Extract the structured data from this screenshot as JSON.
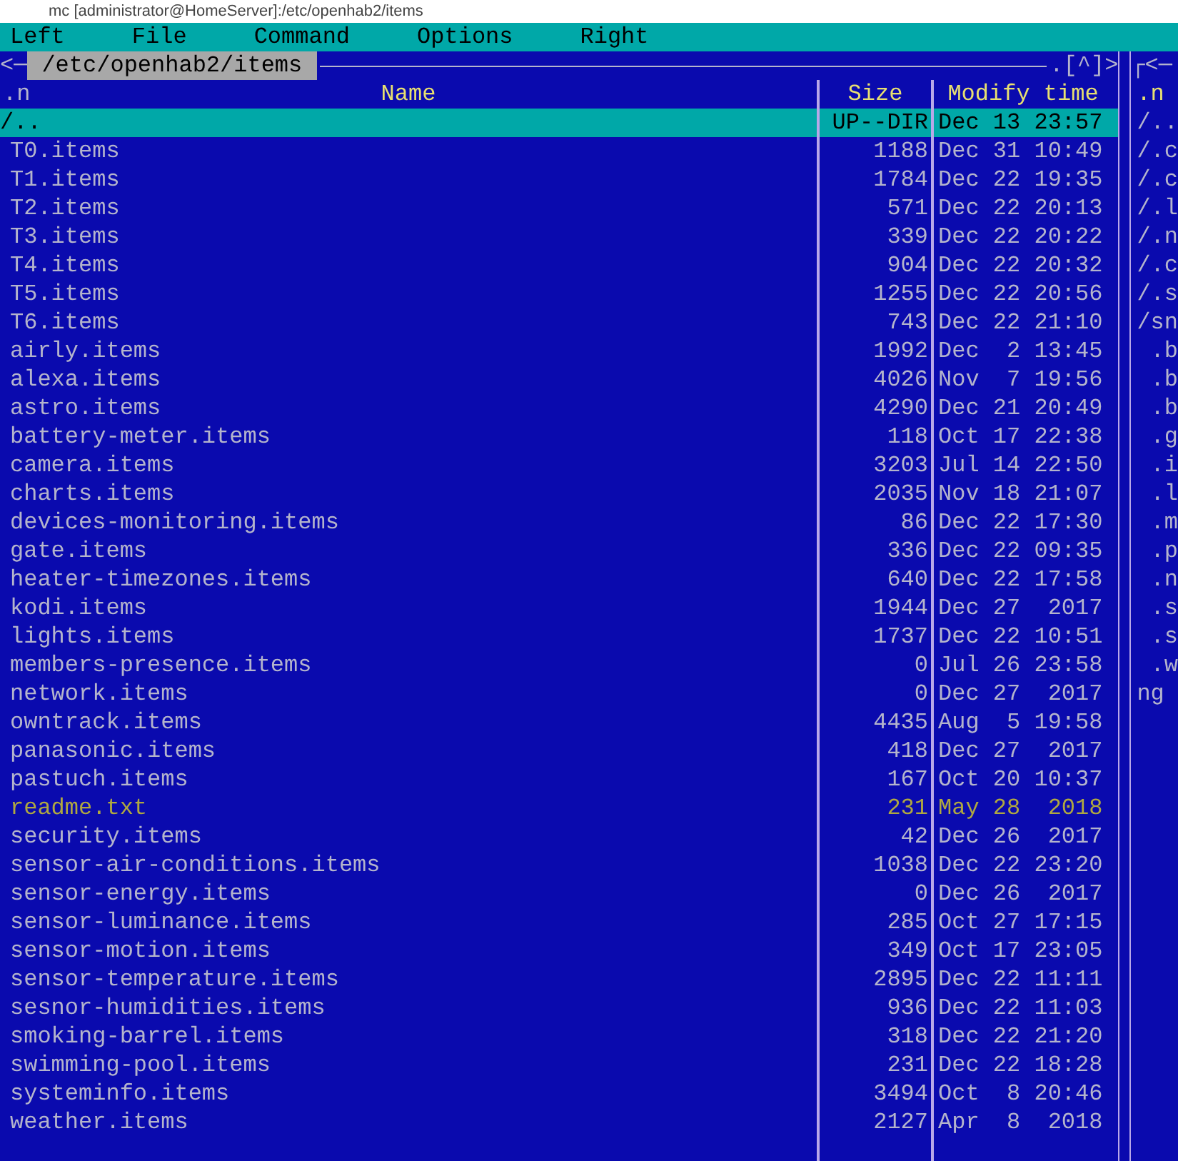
{
  "window": {
    "title": "mc [administrator@HomeServer]:/etc/openhab2/items"
  },
  "menu": [
    "Left",
    "File",
    "Command",
    "Options",
    "Right"
  ],
  "left_panel": {
    "corner": "<─",
    "path": "/etc/openhab2/items",
    "scroll_marker": ".[^]>",
    "columns": [
      ".n",
      "Name",
      "Size",
      "Modify time"
    ],
    "rows": [
      {
        "name": "/..",
        "size": "UP--DIR",
        "modified": "Dec 13 23:57",
        "kind": "updir",
        "selected": true
      },
      {
        "name": "T0.items",
        "size": "1188",
        "modified": "Dec 31 10:49",
        "kind": "file",
        "selected": false
      },
      {
        "name": "T1.items",
        "size": "1784",
        "modified": "Dec 22 19:35",
        "kind": "file",
        "selected": false
      },
      {
        "name": "T2.items",
        "size": "571",
        "modified": "Dec 22 20:13",
        "kind": "file",
        "selected": false
      },
      {
        "name": "T3.items",
        "size": "339",
        "modified": "Dec 22 20:22",
        "kind": "file",
        "selected": false
      },
      {
        "name": "T4.items",
        "size": "904",
        "modified": "Dec 22 20:32",
        "kind": "file",
        "selected": false
      },
      {
        "name": "T5.items",
        "size": "1255",
        "modified": "Dec 22 20:56",
        "kind": "file",
        "selected": false
      },
      {
        "name": "T6.items",
        "size": "743",
        "modified": "Dec 22 21:10",
        "kind": "file",
        "selected": false
      },
      {
        "name": "airly.items",
        "size": "1992",
        "modified": "Dec  2 13:45",
        "kind": "file",
        "selected": false
      },
      {
        "name": "alexa.items",
        "size": "4026",
        "modified": "Nov  7 19:56",
        "kind": "file",
        "selected": false
      },
      {
        "name": "astro.items",
        "size": "4290",
        "modified": "Dec 21 20:49",
        "kind": "file",
        "selected": false
      },
      {
        "name": "battery-meter.items",
        "size": "118",
        "modified": "Oct 17 22:38",
        "kind": "file",
        "selected": false
      },
      {
        "name": "camera.items",
        "size": "3203",
        "modified": "Jul 14 22:50",
        "kind": "file",
        "selected": false
      },
      {
        "name": "charts.items",
        "size": "2035",
        "modified": "Nov 18 21:07",
        "kind": "file",
        "selected": false
      },
      {
        "name": "devices-monitoring.items",
        "size": "86",
        "modified": "Dec 22 17:30",
        "kind": "file",
        "selected": false
      },
      {
        "name": "gate.items",
        "size": "336",
        "modified": "Dec 22 09:35",
        "kind": "file",
        "selected": false
      },
      {
        "name": "heater-timezones.items",
        "size": "640",
        "modified": "Dec 22 17:58",
        "kind": "file",
        "selected": false
      },
      {
        "name": "kodi.items",
        "size": "1944",
        "modified": "Dec 27  2017",
        "kind": "file",
        "selected": false
      },
      {
        "name": "lights.items",
        "size": "1737",
        "modified": "Dec 22 10:51",
        "kind": "file",
        "selected": false
      },
      {
        "name": "members-presence.items",
        "size": "0",
        "modified": "Jul 26 23:58",
        "kind": "file",
        "selected": false
      },
      {
        "name": "network.items",
        "size": "0",
        "modified": "Dec 27  2017",
        "kind": "file",
        "selected": false
      },
      {
        "name": "owntrack.items",
        "size": "4435",
        "modified": "Aug  5 19:58",
        "kind": "file",
        "selected": false
      },
      {
        "name": "panasonic.items",
        "size": "418",
        "modified": "Dec 27  2017",
        "kind": "file",
        "selected": false
      },
      {
        "name": "pastuch.items",
        "size": "167",
        "modified": "Oct 20 10:37",
        "kind": "file",
        "selected": false
      },
      {
        "name": "readme.txt",
        "size": "231",
        "modified": "May 28  2018",
        "kind": "document",
        "selected": false
      },
      {
        "name": "security.items",
        "size": "42",
        "modified": "Dec 26  2017",
        "kind": "file",
        "selected": false
      },
      {
        "name": "sensor-air-conditions.items",
        "size": "1038",
        "modified": "Dec 22 23:20",
        "kind": "file",
        "selected": false
      },
      {
        "name": "sensor-energy.items",
        "size": "0",
        "modified": "Dec 26  2017",
        "kind": "file",
        "selected": false
      },
      {
        "name": "sensor-luminance.items",
        "size": "285",
        "modified": "Oct 27 17:15",
        "kind": "file",
        "selected": false
      },
      {
        "name": "sensor-motion.items",
        "size": "349",
        "modified": "Oct 17 23:05",
        "kind": "file",
        "selected": false
      },
      {
        "name": "sensor-temperature.items",
        "size": "2895",
        "modified": "Dec 22 11:11",
        "kind": "file",
        "selected": false
      },
      {
        "name": "sesnor-humidities.items",
        "size": "936",
        "modified": "Dec 22 11:03",
        "kind": "file",
        "selected": false
      },
      {
        "name": "smoking-barrel.items",
        "size": "318",
        "modified": "Dec 22 21:20",
        "kind": "file",
        "selected": false
      },
      {
        "name": "swimming-pool.items",
        "size": "231",
        "modified": "Dec 22 18:28",
        "kind": "file",
        "selected": false
      },
      {
        "name": "systeminfo.items",
        "size": "3494",
        "modified": "Oct  8 20:46",
        "kind": "file",
        "selected": false
      },
      {
        "name": "weather.items",
        "size": "2127",
        "modified": "Apr  8  2018",
        "kind": "file",
        "selected": false
      }
    ]
  },
  "right_panel": {
    "corner": "┌<─",
    "column": ".n",
    "rows": [
      "/..",
      "/.c",
      "/.c",
      "/.l",
      "/.n",
      "/.c",
      "/.s",
      "/sn",
      " .b",
      " .b",
      " .b",
      " .g",
      " .i",
      " .l",
      " .m",
      " .p",
      " .n",
      " .s",
      " .s",
      " .w",
      "ng"
    ]
  }
}
